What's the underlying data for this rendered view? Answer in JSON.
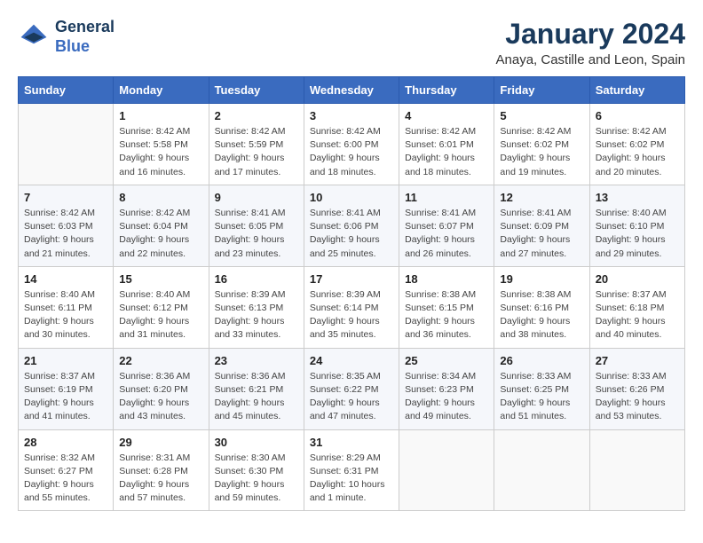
{
  "header": {
    "logo_line1": "General",
    "logo_line2": "Blue",
    "title": "January 2024",
    "subtitle": "Anaya, Castille and Leon, Spain"
  },
  "weekdays": [
    "Sunday",
    "Monday",
    "Tuesday",
    "Wednesday",
    "Thursday",
    "Friday",
    "Saturday"
  ],
  "weeks": [
    [
      {
        "day": "",
        "sunrise": "",
        "sunset": "",
        "daylight": ""
      },
      {
        "day": "1",
        "sunrise": "Sunrise: 8:42 AM",
        "sunset": "Sunset: 5:58 PM",
        "daylight": "Daylight: 9 hours and 16 minutes."
      },
      {
        "day": "2",
        "sunrise": "Sunrise: 8:42 AM",
        "sunset": "Sunset: 5:59 PM",
        "daylight": "Daylight: 9 hours and 17 minutes."
      },
      {
        "day": "3",
        "sunrise": "Sunrise: 8:42 AM",
        "sunset": "Sunset: 6:00 PM",
        "daylight": "Daylight: 9 hours and 18 minutes."
      },
      {
        "day": "4",
        "sunrise": "Sunrise: 8:42 AM",
        "sunset": "Sunset: 6:01 PM",
        "daylight": "Daylight: 9 hours and 18 minutes."
      },
      {
        "day": "5",
        "sunrise": "Sunrise: 8:42 AM",
        "sunset": "Sunset: 6:02 PM",
        "daylight": "Daylight: 9 hours and 19 minutes."
      },
      {
        "day": "6",
        "sunrise": "Sunrise: 8:42 AM",
        "sunset": "Sunset: 6:02 PM",
        "daylight": "Daylight: 9 hours and 20 minutes."
      }
    ],
    [
      {
        "day": "7",
        "sunrise": "Sunrise: 8:42 AM",
        "sunset": "Sunset: 6:03 PM",
        "daylight": "Daylight: 9 hours and 21 minutes."
      },
      {
        "day": "8",
        "sunrise": "Sunrise: 8:42 AM",
        "sunset": "Sunset: 6:04 PM",
        "daylight": "Daylight: 9 hours and 22 minutes."
      },
      {
        "day": "9",
        "sunrise": "Sunrise: 8:41 AM",
        "sunset": "Sunset: 6:05 PM",
        "daylight": "Daylight: 9 hours and 23 minutes."
      },
      {
        "day": "10",
        "sunrise": "Sunrise: 8:41 AM",
        "sunset": "Sunset: 6:06 PM",
        "daylight": "Daylight: 9 hours and 25 minutes."
      },
      {
        "day": "11",
        "sunrise": "Sunrise: 8:41 AM",
        "sunset": "Sunset: 6:07 PM",
        "daylight": "Daylight: 9 hours and 26 minutes."
      },
      {
        "day": "12",
        "sunrise": "Sunrise: 8:41 AM",
        "sunset": "Sunset: 6:09 PM",
        "daylight": "Daylight: 9 hours and 27 minutes."
      },
      {
        "day": "13",
        "sunrise": "Sunrise: 8:40 AM",
        "sunset": "Sunset: 6:10 PM",
        "daylight": "Daylight: 9 hours and 29 minutes."
      }
    ],
    [
      {
        "day": "14",
        "sunrise": "Sunrise: 8:40 AM",
        "sunset": "Sunset: 6:11 PM",
        "daylight": "Daylight: 9 hours and 30 minutes."
      },
      {
        "day": "15",
        "sunrise": "Sunrise: 8:40 AM",
        "sunset": "Sunset: 6:12 PM",
        "daylight": "Daylight: 9 hours and 31 minutes."
      },
      {
        "day": "16",
        "sunrise": "Sunrise: 8:39 AM",
        "sunset": "Sunset: 6:13 PM",
        "daylight": "Daylight: 9 hours and 33 minutes."
      },
      {
        "day": "17",
        "sunrise": "Sunrise: 8:39 AM",
        "sunset": "Sunset: 6:14 PM",
        "daylight": "Daylight: 9 hours and 35 minutes."
      },
      {
        "day": "18",
        "sunrise": "Sunrise: 8:38 AM",
        "sunset": "Sunset: 6:15 PM",
        "daylight": "Daylight: 9 hours and 36 minutes."
      },
      {
        "day": "19",
        "sunrise": "Sunrise: 8:38 AM",
        "sunset": "Sunset: 6:16 PM",
        "daylight": "Daylight: 9 hours and 38 minutes."
      },
      {
        "day": "20",
        "sunrise": "Sunrise: 8:37 AM",
        "sunset": "Sunset: 6:18 PM",
        "daylight": "Daylight: 9 hours and 40 minutes."
      }
    ],
    [
      {
        "day": "21",
        "sunrise": "Sunrise: 8:37 AM",
        "sunset": "Sunset: 6:19 PM",
        "daylight": "Daylight: 9 hours and 41 minutes."
      },
      {
        "day": "22",
        "sunrise": "Sunrise: 8:36 AM",
        "sunset": "Sunset: 6:20 PM",
        "daylight": "Daylight: 9 hours and 43 minutes."
      },
      {
        "day": "23",
        "sunrise": "Sunrise: 8:36 AM",
        "sunset": "Sunset: 6:21 PM",
        "daylight": "Daylight: 9 hours and 45 minutes."
      },
      {
        "day": "24",
        "sunrise": "Sunrise: 8:35 AM",
        "sunset": "Sunset: 6:22 PM",
        "daylight": "Daylight: 9 hours and 47 minutes."
      },
      {
        "day": "25",
        "sunrise": "Sunrise: 8:34 AM",
        "sunset": "Sunset: 6:23 PM",
        "daylight": "Daylight: 9 hours and 49 minutes."
      },
      {
        "day": "26",
        "sunrise": "Sunrise: 8:33 AM",
        "sunset": "Sunset: 6:25 PM",
        "daylight": "Daylight: 9 hours and 51 minutes."
      },
      {
        "day": "27",
        "sunrise": "Sunrise: 8:33 AM",
        "sunset": "Sunset: 6:26 PM",
        "daylight": "Daylight: 9 hours and 53 minutes."
      }
    ],
    [
      {
        "day": "28",
        "sunrise": "Sunrise: 8:32 AM",
        "sunset": "Sunset: 6:27 PM",
        "daylight": "Daylight: 9 hours and 55 minutes."
      },
      {
        "day": "29",
        "sunrise": "Sunrise: 8:31 AM",
        "sunset": "Sunset: 6:28 PM",
        "daylight": "Daylight: 9 hours and 57 minutes."
      },
      {
        "day": "30",
        "sunrise": "Sunrise: 8:30 AM",
        "sunset": "Sunset: 6:30 PM",
        "daylight": "Daylight: 9 hours and 59 minutes."
      },
      {
        "day": "31",
        "sunrise": "Sunrise: 8:29 AM",
        "sunset": "Sunset: 6:31 PM",
        "daylight": "Daylight: 10 hours and 1 minute."
      },
      {
        "day": "",
        "sunrise": "",
        "sunset": "",
        "daylight": ""
      },
      {
        "day": "",
        "sunrise": "",
        "sunset": "",
        "daylight": ""
      },
      {
        "day": "",
        "sunrise": "",
        "sunset": "",
        "daylight": ""
      }
    ]
  ]
}
